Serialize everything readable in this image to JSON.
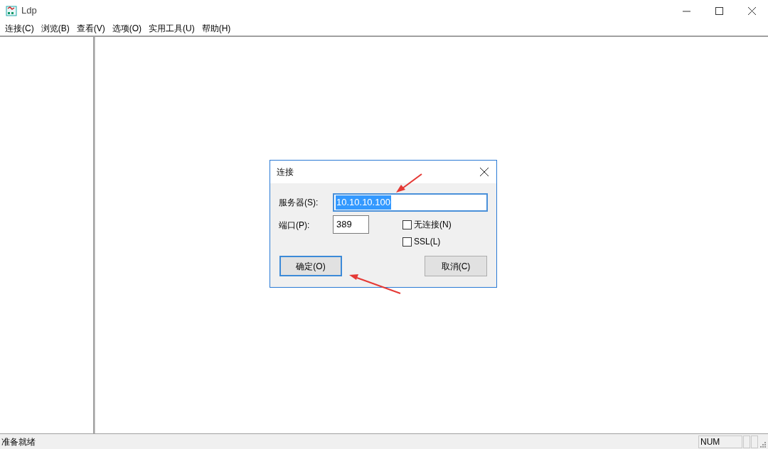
{
  "window": {
    "title": "Ldp"
  },
  "menu": [
    {
      "label": "连接(C)"
    },
    {
      "label": "浏览(B)"
    },
    {
      "label": "查看(V)"
    },
    {
      "label": "选项(O)"
    },
    {
      "label": "实用工具(U)"
    },
    {
      "label": "帮助(H)"
    }
  ],
  "dialog": {
    "title": "连接",
    "server": {
      "label": "服务器(S):",
      "value": "10.10.10.100",
      "selected": true
    },
    "port": {
      "label": "端口(P):",
      "value": "389"
    },
    "options": [
      {
        "label": "无连接(N)",
        "checked": false
      },
      {
        "label": "SSL(L)",
        "checked": false
      }
    ],
    "buttons": [
      {
        "label": "确定(O)",
        "default": true
      },
      {
        "label": "取消(C)",
        "default": false
      }
    ]
  },
  "status_bar": {
    "message": "准备就绪",
    "indicators": [
      "NUM"
    ]
  }
}
